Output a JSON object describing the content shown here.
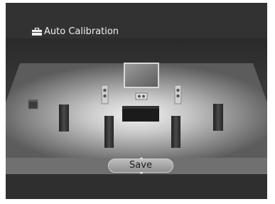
{
  "header": {
    "title": "Auto Calibration",
    "icon": "toolbox-icon"
  },
  "footer": {
    "save_label": "Save"
  },
  "colors": {
    "screen_background": "#313131",
    "room_floor": "#8a8a8a",
    "footer_bar": "#707070",
    "button_fill": "#a8a8a8",
    "title_text": "#f0f0f0"
  }
}
